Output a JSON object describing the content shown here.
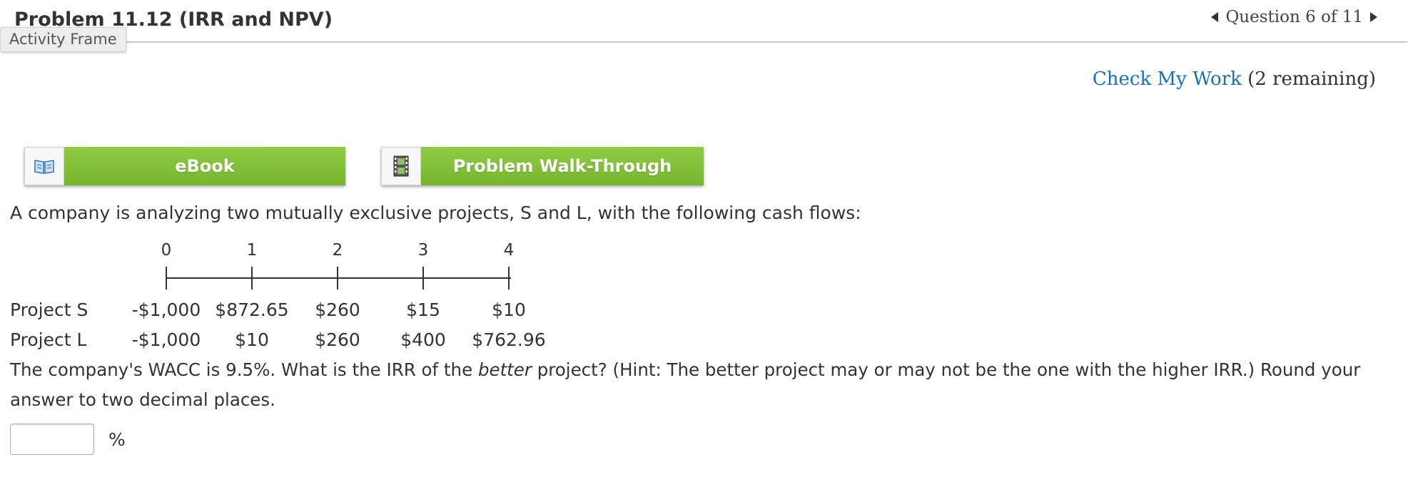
{
  "header": {
    "title": "Problem 11.12 (IRR and NPV)",
    "frame_label": "Activity Frame",
    "question_nav": "Question 6 of 11"
  },
  "check_work": {
    "link": "Check My Work",
    "remaining": "(2 remaining)"
  },
  "resources": {
    "ebook": "eBook",
    "walkthrough": "Problem Walk-Through"
  },
  "problem": {
    "intro": "A company is analyzing two mutually exclusive projects, S and L, with the following cash flows:",
    "periods": [
      "0",
      "1",
      "2",
      "3",
      "4"
    ],
    "projects": [
      {
        "name": "Project S",
        "cash_flows": [
          "-$1,000",
          "$872.65",
          "$260",
          "$15",
          "$10"
        ]
      },
      {
        "name": "Project L",
        "cash_flows": [
          "-$1,000",
          "$10",
          "$260",
          "$400",
          "$762.96"
        ]
      }
    ],
    "question_pre": "The company's WACC is 9.5%. What is the IRR of the ",
    "question_em": "better",
    "question_post": " project? (Hint: The better project may or may not be the one with the higher IRR.) Round your answer to two decimal places.",
    "answer_value": "",
    "unit": "%"
  },
  "colors": {
    "link": "#1a6fb3",
    "button_green": "#82c03a"
  },
  "icons": {
    "ebook": "book-icon",
    "walkthrough": "film-icon",
    "prev": "triangle-left-icon",
    "next": "triangle-right-icon"
  }
}
